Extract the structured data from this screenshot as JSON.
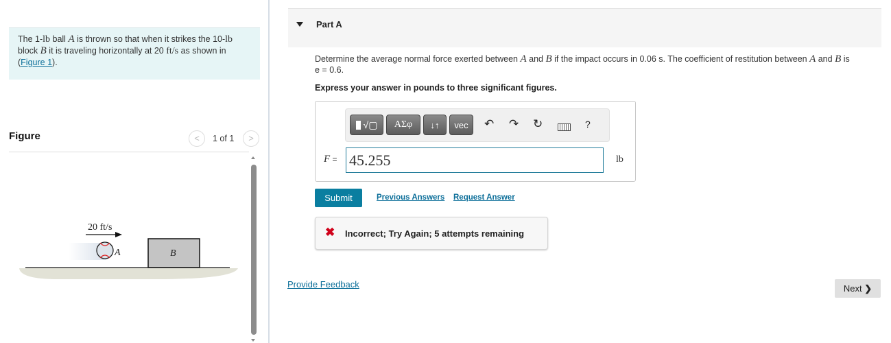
{
  "problem": {
    "t1": "The 1-",
    "lb": "lb",
    "t2": " ball ",
    "A": "A",
    "t3": " is thrown so that when it strikes the 10-",
    "t4": "block ",
    "B": "B",
    "t5": " it is traveling horizontally at 20 ",
    "ftps": "ft/s",
    "t6": " as shown in",
    "open": "(",
    "figlink": "Figure 1",
    "close": ")."
  },
  "figure": {
    "heading": "Figure",
    "pager": "1 of 1",
    "speed_label": "20 ft/s",
    "ball_label": "A",
    "block_label": "B"
  },
  "part": {
    "title": "Part A",
    "q1": "Determine the average normal force exerted between ",
    "qA": "A",
    "q2": " and ",
    "qB": "B",
    "q3": " if the impact occurs in 0.06 s. The coefficient of restitution between ",
    "q4": " is",
    "q5": "e = 0.6.",
    "instruction": "Express your answer in pounds to three significant figures."
  },
  "toolbar": {
    "greek": "ΑΣφ",
    "arrows": "↓↑",
    "vec": "vec",
    "help": "?"
  },
  "answer": {
    "var": "F",
    "eq": " =",
    "value": "45.255",
    "unit": "lb"
  },
  "actions": {
    "submit": "Submit",
    "previous": "Previous Answers",
    "request": "Request Answer"
  },
  "feedback": {
    "message": "Incorrect; Try Again; 5 attempts remaining",
    "color": "#d0021b"
  },
  "footer": {
    "provide_feedback": "Provide Feedback",
    "next": "Next"
  },
  "colors": {
    "accent": "#0a7ea0",
    "problem_bg": "#e6f5f6"
  }
}
